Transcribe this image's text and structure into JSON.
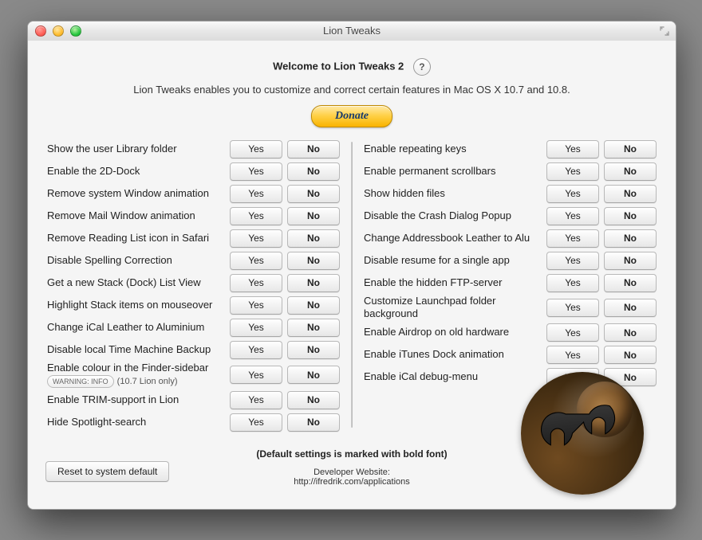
{
  "window": {
    "title": "Lion Tweaks"
  },
  "header": {
    "welcome": "Welcome to Lion Tweaks 2",
    "description": "Lion Tweaks enables you to customize and correct certain features in Mac OS X 10.7 and 10.8.",
    "help_icon": "?",
    "donate_label": "Donate"
  },
  "buttons": {
    "yes": "Yes",
    "no": "No"
  },
  "left_items": [
    {
      "label": "Show the user Library folder",
      "default": "no"
    },
    {
      "label": "Enable the 2D-Dock",
      "default": "no"
    },
    {
      "label": "Remove system Window animation",
      "default": "no"
    },
    {
      "label": "Remove Mail Window animation",
      "default": "no"
    },
    {
      "label": "Remove Reading List icon in Safari",
      "default": "no"
    },
    {
      "label": "Disable Spelling Correction",
      "default": "no"
    },
    {
      "label": "Get a new Stack (Dock) List View",
      "default": "no"
    },
    {
      "label": "Highlight Stack items on mouseover",
      "default": "no"
    },
    {
      "label": "Change iCal Leather to Aluminium",
      "default": "no"
    },
    {
      "label": "Disable local Time Machine Backup",
      "default": "no"
    },
    {
      "label": "Enable colour in the Finder-sidebar",
      "default": "no",
      "warning_pill": "WARNING: INFO",
      "suffix": "(10.7 Lion only)"
    },
    {
      "label": "Enable TRIM-support in Lion",
      "default": "no"
    },
    {
      "label": "Hide Spotlight-search",
      "default": "no"
    }
  ],
  "right_items": [
    {
      "label": "Enable repeating keys",
      "default": "no"
    },
    {
      "label": "Enable permanent scrollbars",
      "default": "no"
    },
    {
      "label": "Show hidden files",
      "default": "no"
    },
    {
      "label": "Disable the Crash Dialog Popup",
      "default": "no"
    },
    {
      "label": "Change Addressbook Leather to Alu",
      "default": "no"
    },
    {
      "label": "Disable resume for a single app",
      "default": "no"
    },
    {
      "label": "Enable the hidden FTP-server",
      "default": "no"
    },
    {
      "label": "Customize Launchpad folder background",
      "default": "no"
    },
    {
      "label": "Enable Airdrop on old hardware",
      "default": "no"
    },
    {
      "label": "Enable iTunes Dock animation",
      "default": "no"
    },
    {
      "label": "Enable iCal debug-menu",
      "default": "no"
    }
  ],
  "footer": {
    "default_note": "(Default settings is marked with bold font)",
    "reset_label": "Reset to system default",
    "dev_label": "Developer Website:",
    "dev_url": "http://ifredrik.com/applications"
  }
}
